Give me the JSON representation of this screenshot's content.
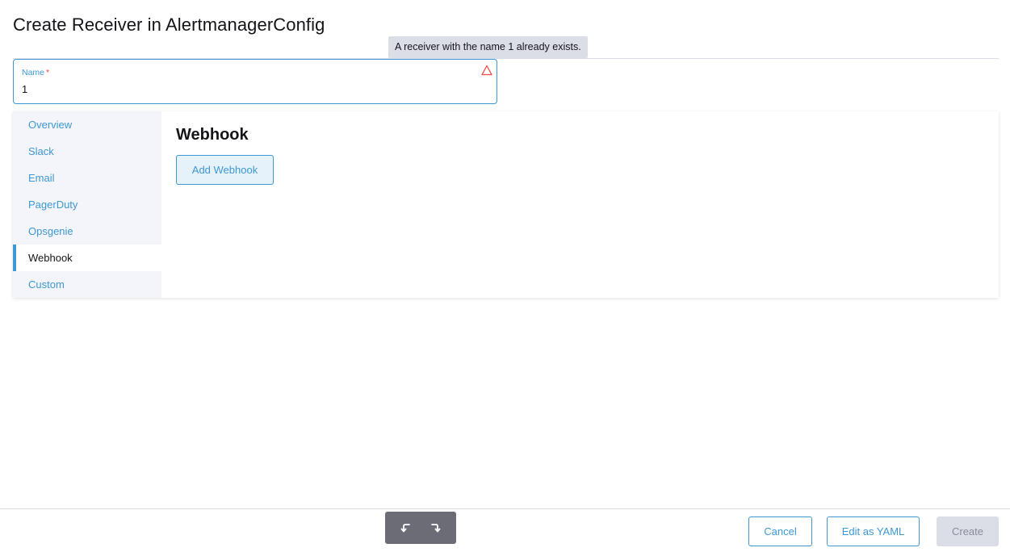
{
  "header": {
    "title": "Create Receiver in AlertmanagerConfig"
  },
  "tooltip": {
    "text": "A receiver with the name 1 already exists."
  },
  "name_field": {
    "label": "Name",
    "required_marker": "*",
    "value": "1",
    "status_icon": "warning-triangle-icon",
    "status_color": "#f64747"
  },
  "side_tabs": [
    {
      "label": "Overview",
      "active": false
    },
    {
      "label": "Slack",
      "active": false
    },
    {
      "label": "Email",
      "active": false
    },
    {
      "label": "PagerDuty",
      "active": false
    },
    {
      "label": "Opsgenie",
      "active": false
    },
    {
      "label": "Webhook",
      "active": true
    },
    {
      "label": "Custom",
      "active": false
    }
  ],
  "content": {
    "title": "Webhook",
    "add_button_label": "Add Webhook"
  },
  "footer": {
    "undo_icon": "undo-arrow-icon",
    "redo_icon": "redo-arrow-icon",
    "cancel_label": "Cancel",
    "edit_yaml_label": "Edit as YAML",
    "create_label": "Create",
    "create_disabled": true
  },
  "colors": {
    "accent": "#3d98d3",
    "error": "#f64747",
    "disabled_bg": "#dcdee7"
  }
}
